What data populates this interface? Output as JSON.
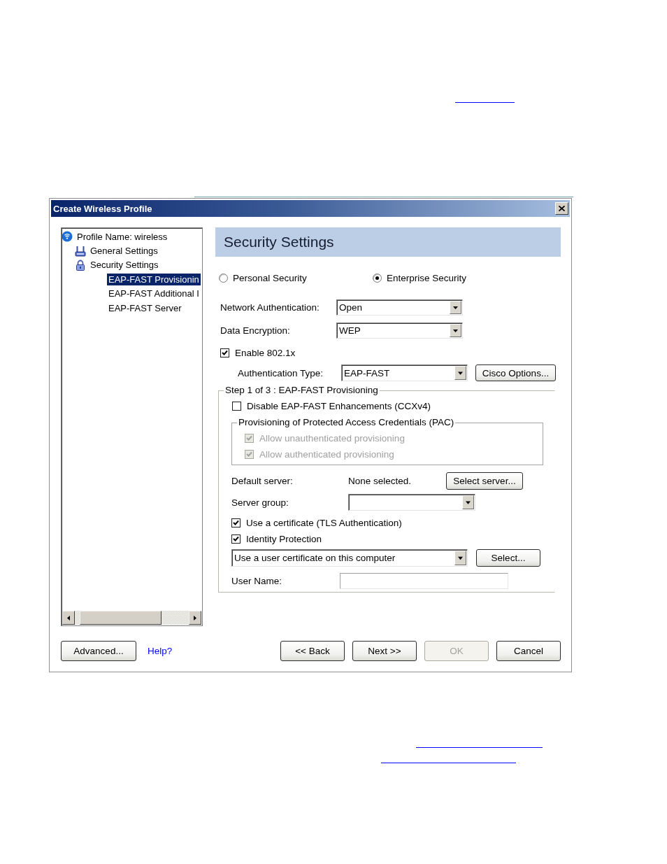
{
  "window": {
    "title": "Create Wireless Profile"
  },
  "tree": {
    "items": [
      {
        "label": "Profile Name: wireless",
        "kind": "profile",
        "selected": false,
        "children": [
          {
            "label": "General Settings",
            "kind": "general",
            "selected": false
          },
          {
            "label": "Security Settings",
            "kind": "security",
            "selected": false,
            "children": [
              {
                "label": "EAP-FAST Provisionin",
                "selected": true
              },
              {
                "label": "EAP-FAST Additional I",
                "selected": false
              },
              {
                "label": "EAP-FAST Server",
                "selected": false
              }
            ]
          }
        ]
      }
    ]
  },
  "panel": {
    "heading": "Security Settings",
    "security_mode": [
      {
        "label": "Personal Security",
        "selected": false
      },
      {
        "label": "Enterprise Security",
        "selected": true
      }
    ],
    "network_authentication": {
      "label": "Network Authentication:",
      "value": "Open"
    },
    "data_encryption": {
      "label": "Data Encryption:",
      "value": "WEP"
    },
    "enable_8021x": {
      "label": "Enable 802.1x",
      "checked": true
    },
    "authentication_type": {
      "label": "Authentication Type:",
      "value": "EAP-FAST",
      "button": "Cisco Options..."
    },
    "provisioning": {
      "legend": "Step 1 of 3 : EAP-FAST Provisioning",
      "disable_enhancements": {
        "label": "Disable EAP-FAST Enhancements (CCXv4)",
        "checked": false
      },
      "pac": {
        "legend": "Provisioning of Protected Access Credentials (PAC)",
        "options": [
          {
            "label": "Allow unauthenticated provisioning",
            "checked": true,
            "disabled": true
          },
          {
            "label": "Allow authenticated provisioning",
            "checked": true,
            "disabled": true
          }
        ]
      },
      "default_server": {
        "label": "Default server:",
        "value": "None selected.",
        "button": "Select server..."
      },
      "server_group": {
        "label": "Server group:"
      },
      "options": [
        {
          "label": "Use a certificate (TLS Authentication)",
          "checked": true
        },
        {
          "label": "Identity Protection",
          "checked": true
        }
      ],
      "certificate": {
        "value": "Use a user certificate on this computer",
        "button": "Select..."
      },
      "user_name": {
        "label": "User Name:"
      }
    }
  },
  "footer": {
    "advanced": "Advanced...",
    "help": "Help?",
    "buttons": [
      {
        "label": "<< Back",
        "disabled": false
      },
      {
        "label": "Next >>",
        "disabled": false
      },
      {
        "label": "OK",
        "disabled": true
      },
      {
        "label": "Cancel",
        "disabled": false
      }
    ]
  }
}
